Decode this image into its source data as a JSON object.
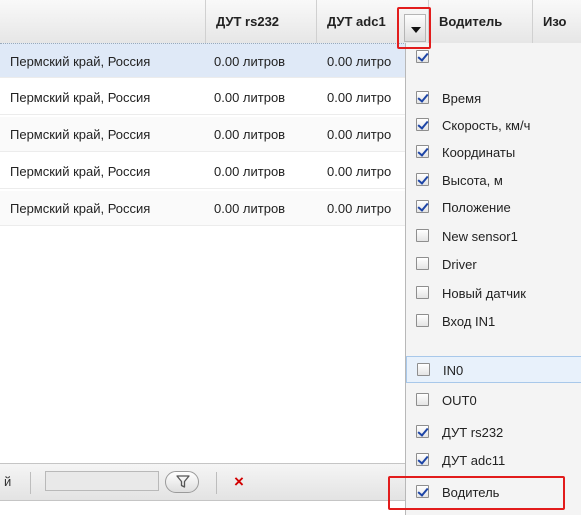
{
  "header": {
    "columns": [
      {
        "label": "ДУТ rs232"
      },
      {
        "label": "ДУТ adc1"
      },
      {
        "label": "Водитель"
      },
      {
        "label": "Изо"
      }
    ]
  },
  "rows": [
    {
      "location": "Пермский край, Россия",
      "rs232": "0.00 литров",
      "adc": "0.00 литро"
    },
    {
      "location": "Пермский край, Россия",
      "rs232": "0.00 литров",
      "adc": "0.00 литро"
    },
    {
      "location": "Пермский край, Россия",
      "rs232": "0.00 литров",
      "adc": "0.00 литро"
    },
    {
      "location": "Пермский край, Россия",
      "rs232": "0.00 литров",
      "adc": "0.00 литро"
    },
    {
      "location": "Пермский край, Россия",
      "rs232": "0.00 литров",
      "adc": "0.00 литро"
    }
  ],
  "column_menu": {
    "items": [
      {
        "label": "Время",
        "checked": true
      },
      {
        "label": "Скорость, км/ч",
        "checked": true
      },
      {
        "label": "Координаты",
        "checked": true
      },
      {
        "label": "Высота, м",
        "checked": true
      },
      {
        "label": "Положение",
        "checked": true
      },
      {
        "label": "New sensor1",
        "checked": false
      },
      {
        "label": "Driver",
        "checked": false
      },
      {
        "label": "Новый датчик",
        "checked": false
      },
      {
        "label": "Вход IN1",
        "checked": false
      },
      {
        "label": "IN0",
        "checked": false
      },
      {
        "label": "OUT0",
        "checked": false
      },
      {
        "label": "ДУТ rs232",
        "checked": true
      },
      {
        "label": "ДУТ adc11",
        "checked": true
      },
      {
        "label": "Водитель",
        "checked": true
      }
    ]
  },
  "toolbar": {
    "label": "й",
    "close_glyph": "×"
  },
  "colors": {
    "highlight": "#e21c1c",
    "selected_row": "#dfe9f7",
    "hover_item": "#e8f1fb"
  }
}
